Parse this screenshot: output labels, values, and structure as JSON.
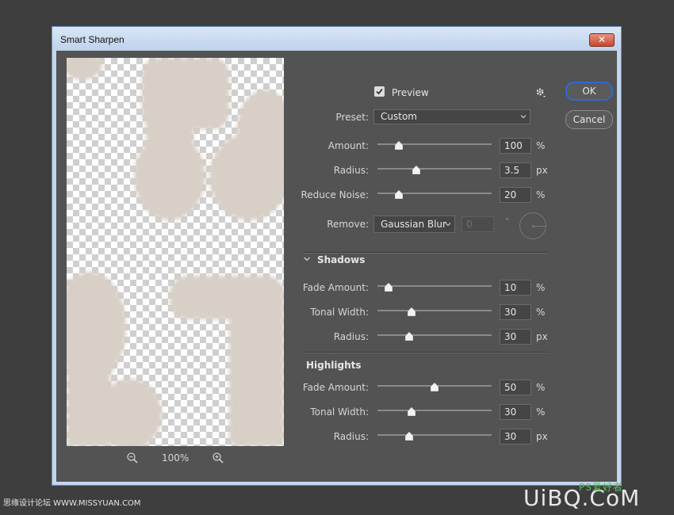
{
  "window": {
    "title": "Smart Sharpen",
    "close_label": "✕"
  },
  "preview": {
    "checkbox_label": "Preview",
    "checked": true,
    "zoom": "100%",
    "zoom_in_icon": "zoom-in-icon",
    "zoom_out_icon": "zoom-out-icon",
    "settings_icon": "gear-icon"
  },
  "buttons": {
    "ok": "OK",
    "cancel": "Cancel"
  },
  "preset": {
    "label": "Preset:",
    "value": "Custom"
  },
  "sharpen": {
    "amount": {
      "label": "Amount:",
      "value": "100",
      "unit": "%",
      "level": 0.19
    },
    "radius": {
      "label": "Radius:",
      "value": "3.5",
      "unit": "px",
      "level": 0.34
    },
    "reduce_noise": {
      "label": "Reduce Noise:",
      "value": "20",
      "unit": "%",
      "level": 0.19
    }
  },
  "remove": {
    "label": "Remove:",
    "value": "Gaussian Blur",
    "angle": "0",
    "degree": "°"
  },
  "shadows": {
    "heading": "Shadows",
    "fade_amount": {
      "label": "Fade Amount:",
      "value": "10",
      "unit": "%",
      "level": 0.1
    },
    "tonal_width": {
      "label": "Tonal Width:",
      "value": "30",
      "unit": "%",
      "level": 0.3
    },
    "radius": {
      "label": "Radius:",
      "value": "30",
      "unit": "px",
      "level": 0.28
    }
  },
  "highlights": {
    "heading": "Highlights",
    "fade_amount": {
      "label": "Fade Amount:",
      "value": "50",
      "unit": "%",
      "level": 0.5
    },
    "tonal_width": {
      "label": "Tonal Width:",
      "value": "30",
      "unit": "%",
      "level": 0.3
    },
    "radius": {
      "label": "Radius:",
      "value": "30",
      "unit": "px",
      "level": 0.28
    }
  },
  "watermark": {
    "left": "思缘设计论坛 WWW.MISSYUAN.COM",
    "right": "UiBQ.CoM",
    "right_small": "PS爱好者"
  },
  "colors": {
    "dialog_bg": "#535353",
    "accent": "#2f6ad1"
  }
}
